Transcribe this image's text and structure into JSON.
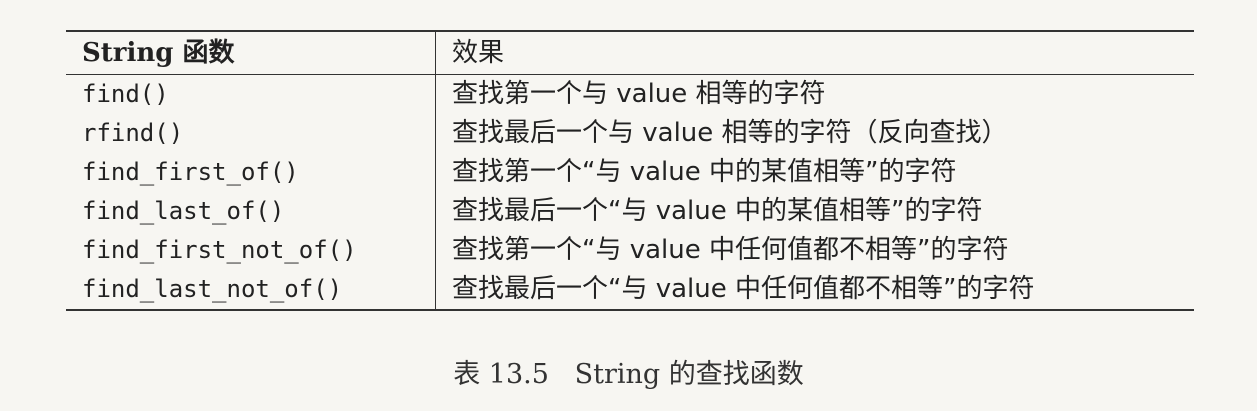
{
  "table": {
    "headers": {
      "function": "String 函数",
      "effect": "效果"
    },
    "rows": [
      {
        "function": "find()",
        "effect": "查找第一个与 value 相等的字符"
      },
      {
        "function": "rfind()",
        "effect": "查找最后一个与 value 相等的字符（反向查找）"
      },
      {
        "function": "find_first_of()",
        "effect": "查找第一个“与 value 中的某值相等”的字符"
      },
      {
        "function": "find_last_of()",
        "effect": "查找最后一个“与 value 中的某值相等”的字符"
      },
      {
        "function": "find_first_not_of()",
        "effect": "查找第一个“与 value 中任何值都不相等”的字符"
      },
      {
        "function": "find_last_not_of()",
        "effect": "查找最后一个“与 value 中任何值都不相等”的字符"
      }
    ]
  },
  "caption": "表 13.5   String 的查找函数"
}
